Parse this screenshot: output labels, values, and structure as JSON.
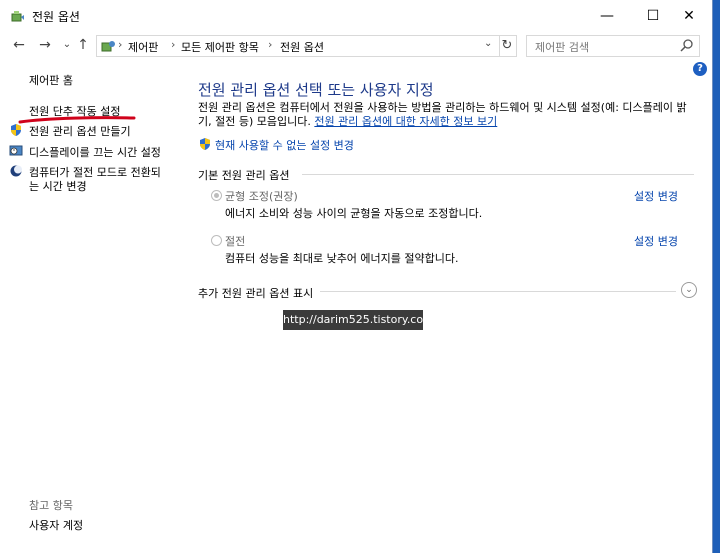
{
  "window": {
    "title": "전원 옵션",
    "min": "—",
    "max": "☐",
    "close": "✕"
  },
  "nav": {
    "back": "←",
    "forward": "→",
    "recent": "⌄",
    "up": "↑"
  },
  "address": {
    "crumbs": [
      "제어판",
      "모든 제어판 항목",
      "전원 옵션"
    ],
    "sep": "›",
    "dropdown": "⌄",
    "refresh": "↻"
  },
  "search": {
    "placeholder": "제어판 검색"
  },
  "help": "?",
  "left_pane": {
    "home": "제어판 홈",
    "links": [
      "전원 단추 작동 설정",
      "전원 관리 옵션 만들기",
      "디스플레이를 끄는 시간 설정",
      "컴퓨터가 절전 모드로 전환되",
      "는 시간 변경"
    ],
    "see_also": "참고 항목",
    "user_accounts": "사용자 계정"
  },
  "main": {
    "title": "전원 관리 옵션 선택 또는 사용자 지정",
    "desc_line1": "전원 관리 옵션은 컴퓨터에서 전원을 사용하는 방법을 관리하는 하드웨어 및 시스템 설정(예: 디스플레이 밝",
    "desc_line2_prefix": "기, 절전 등) 모음입니다. ",
    "desc_link": "전원 관리 옵션에 대한 자세한 정보 보기",
    "unavailable_link": "현재 사용할 수 없는 설정 변경",
    "section_title": "기본 전원 관리 옵션",
    "plans": [
      {
        "name": "균형 조정(권장)",
        "desc": "에너지 소비와 성능 사이의 균형을 자동으로 조정합니다.",
        "change": "설정 변경",
        "selected": true
      },
      {
        "name": "절전",
        "desc": "컴퓨터 성능을 최대로 낮추어 에너지를 절약합니다.",
        "change": "설정 변경",
        "selected": false
      }
    ],
    "more_plans": "추가 전원 관리 옵션 표시",
    "expand": "⌄"
  },
  "watermark": "http://darim525.tistory.com",
  "colors": {
    "accent_link": "#0645ad",
    "title_blue": "#1e3a8a",
    "annotation_red": "#d0021b",
    "desktop": "#1f5fb8"
  }
}
